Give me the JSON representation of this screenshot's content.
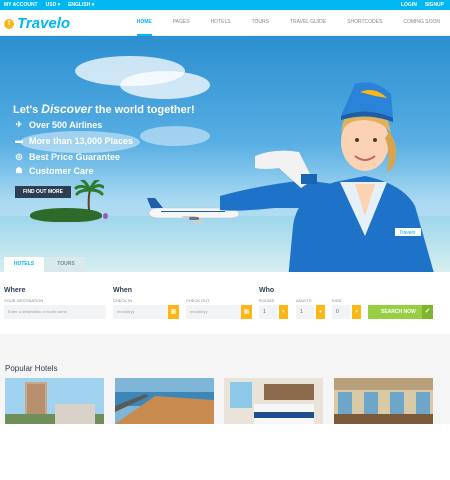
{
  "topbar": {
    "account": "MY ACCOUNT",
    "currency": "USD ▾",
    "language": "ENGLISH ▾",
    "login": "LOGIN",
    "signup": "SIGNUP"
  },
  "brand": {
    "mark": "t",
    "name": "Travelo",
    "accent": "#01b7f2"
  },
  "nav": [
    "HOME",
    "PAGES",
    "HOTELS",
    "TOURS",
    "TRAVEL GUIDE",
    "SHORTCODES",
    "COMING SOON"
  ],
  "hero": {
    "title_pre": "Let's ",
    "title_em": "Discover",
    "title_post": " the world together!",
    "features": [
      {
        "icon": "plane-icon",
        "glyph": "✈",
        "text": "Over 500 Airlines"
      },
      {
        "icon": "bed-icon",
        "glyph": "▬",
        "text": "More than 13,000 Places"
      },
      {
        "icon": "badge-icon",
        "glyph": "◎",
        "text": "Best Price Guarantee"
      },
      {
        "icon": "headset-icon",
        "glyph": "☗",
        "text": "Customer Care"
      }
    ],
    "button": "FIND OUT MORE",
    "name_tag": "Travelo"
  },
  "tabs": [
    "HOTELS",
    "TOURS"
  ],
  "search": {
    "where": "Where",
    "when": "When",
    "who": "Who",
    "destination_label": "YOUR DESTINATION",
    "destination_placeholder": "Enter a destination or hotel name",
    "checkin_label": "CHECK IN",
    "checkout_label": "CHECK OUT",
    "date_placeholder": "mm/dd/yy",
    "rooms_label": "ROOMS",
    "adults_label": "ADULTS",
    "kids_label": "KIDS",
    "rooms": "1",
    "adults": "1",
    "kids": "0",
    "button": "SEARCH NOW"
  },
  "popular": {
    "title": "Popular Hotels"
  }
}
